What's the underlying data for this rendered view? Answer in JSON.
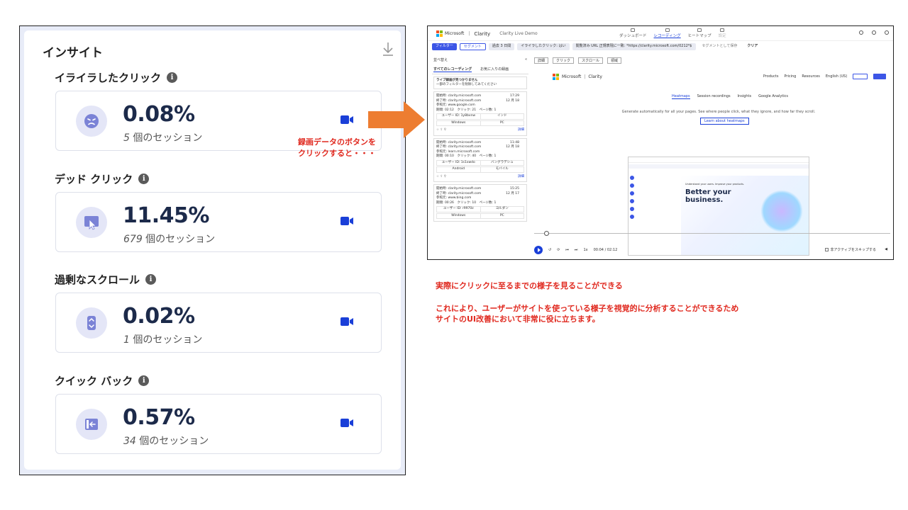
{
  "insight": {
    "title": "インサイト",
    "metrics": [
      {
        "heading": "イライラしたクリック",
        "value": "0.08%",
        "count": "5",
        "sessions_suffix": " 個のセッション"
      },
      {
        "heading": "デッド クリック",
        "value": "11.45%",
        "count": "679",
        "sessions_suffix": " 個のセッション"
      },
      {
        "heading": "過剰なスクロール",
        "value": "0.02%",
        "count": "1",
        "sessions_suffix": " 個のセッション"
      },
      {
        "heading": "クイック バック",
        "value": "0.57%",
        "count": "34",
        "sessions_suffix": " 個のセッション"
      }
    ],
    "info_glyph": "i"
  },
  "annotations": {
    "arrow_note_line1": "録画データのボタンを",
    "arrow_note_line2": "クリックすると・・・",
    "bottom_line1": "実際にクリックに至るまでの様子を見ることができる",
    "bottom_line2": "これにより、ユーザーがサイトを使っている様子を視覚的に分析することができるため",
    "bottom_line3": "サイトのUI改善において非常に役に立ちます。"
  },
  "colors": {
    "accent": "#3c56e6",
    "arrow": "#ed7d31",
    "note_red": "#e0291f",
    "icon_purple": "#7b83d6"
  },
  "screenshot": {
    "brand": "Microsoft",
    "app": "Clarity",
    "project": "Clarity Live Demo",
    "nav": [
      "ダッシュボード",
      "レコーディング",
      "ヒートマップ",
      "設定"
    ],
    "filters": [
      "フィルター",
      "セグメント",
      "過去 3 日間",
      "イライラしたクリック: はい",
      "閲覧済み URL 正規表現に一致: *https://clarity.microsoft.com/0212*$",
      "セグメントとして保存",
      "クリア"
    ],
    "sidebar": {
      "sort": "並べ替え",
      "tabs": [
        "すべてのレコーディング",
        "お気に入りの録画"
      ],
      "live_notice_title": "ライブ録画が見つかりません",
      "live_notice_body": "一部のフィルターを削除してみてください",
      "cards": [
        {
          "entry": "開始時: clarity.microsoft.com",
          "exit": "終了時: clarity.microsoft.com",
          "ref": "参照元: www.google.com",
          "stats": "期間: 02:12　クリック: 21　ページ数: 1",
          "time": "17:29",
          "date": "12 月 18",
          "user": "ユーザー ID: 1y8bvnw",
          "country": "インド",
          "os": "Windows",
          "device": "PC",
          "detail": "詳細"
        },
        {
          "entry": "開始時: clarity.microsoft.com",
          "exit": "終了時: clarity.microsoft.com",
          "ref": "参照元: learn.microsoft.com",
          "stats": "期間: 00:10　クリック: 40　ページ数: 1",
          "time": "11:48",
          "date": "12 月 18",
          "user": "ユーザー ID: 1s1xwdo",
          "country": "バングラデシュ",
          "os": "Android",
          "device": "モバイル",
          "detail": "詳細"
        },
        {
          "entry": "開始時: clarity.microsoft.com",
          "exit": "終了時: clarity.microsoft.com",
          "ref": "参照元: www.bing.com",
          "stats": "期間: 00:26　クリック: 10　ページ数: 1",
          "time": "15:25",
          "date": "12 月 17",
          "user": "ユーザー ID: r9970z",
          "country": "ヨルダン",
          "os": "Windows",
          "device": "PC",
          "detail": "詳細"
        }
      ]
    },
    "player_tools": [
      "詳細",
      "クリック",
      "スクロール",
      "領域"
    ],
    "page": {
      "nav_items": [
        "Products",
        "Pricing",
        "Resources",
        "English (US)"
      ],
      "tabs": [
        "Heatmaps",
        "Session recordings",
        "Insights",
        "Google Analytics"
      ],
      "subtitle": "Generate automatically for all your pages. See where people click, what they ignore, and how far they scroll.",
      "learn": "Learn about heatmaps",
      "inner_pre": "Understand your users. Improve your products.",
      "inner_title_1": "Better your",
      "inner_title_2": "business."
    },
    "controls": {
      "speed": "1x",
      "time": "00:04 / 02:12",
      "skip": "非アクティブをスキップする"
    }
  }
}
